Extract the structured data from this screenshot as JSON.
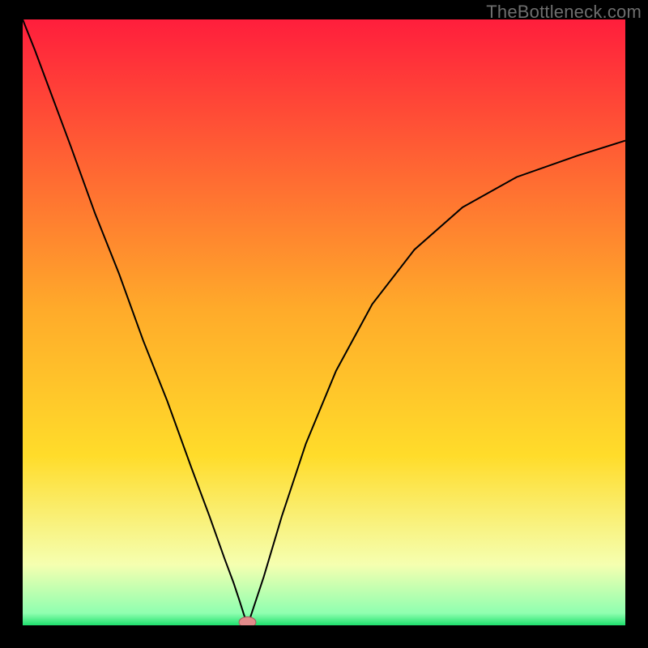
{
  "watermark": "TheBottleneck.com",
  "colors": {
    "frame_bg": "#000000",
    "curve": "#000000",
    "watermark": "#6e6e6e",
    "grad_top": "#ff1e3c",
    "grad_mid": "#ffdc2a",
    "grad_pale": "#f5ffb0",
    "grad_green": "#1fe06e",
    "marker_fill": "#e28b8b",
    "marker_stroke": "#a86060"
  },
  "chart_data": {
    "type": "line",
    "title": "",
    "xlabel": "",
    "ylabel": "",
    "xlim": [
      0,
      100
    ],
    "ylim": [
      0,
      100
    ],
    "background": "vertical-gradient red→orange→yellow→pale→green",
    "series": [
      {
        "name": "bottleneck-curve",
        "x": [
          0,
          2,
          5,
          8,
          12,
          16,
          20,
          24,
          28,
          31,
          33.5,
          35,
          36,
          36.8,
          37.5,
          38,
          40,
          43,
          47,
          52,
          58,
          65,
          73,
          82,
          92,
          100
        ],
        "y": [
          100,
          95,
          87,
          79,
          68,
          58,
          47,
          37,
          26,
          18,
          11,
          7,
          4,
          1.5,
          0.5,
          2,
          8,
          18,
          30,
          42,
          53,
          62,
          69,
          74,
          77.5,
          80
        ]
      }
    ],
    "marker": {
      "x": 37.3,
      "y": 0.5,
      "rx": 1.4,
      "ry": 0.9
    }
  }
}
